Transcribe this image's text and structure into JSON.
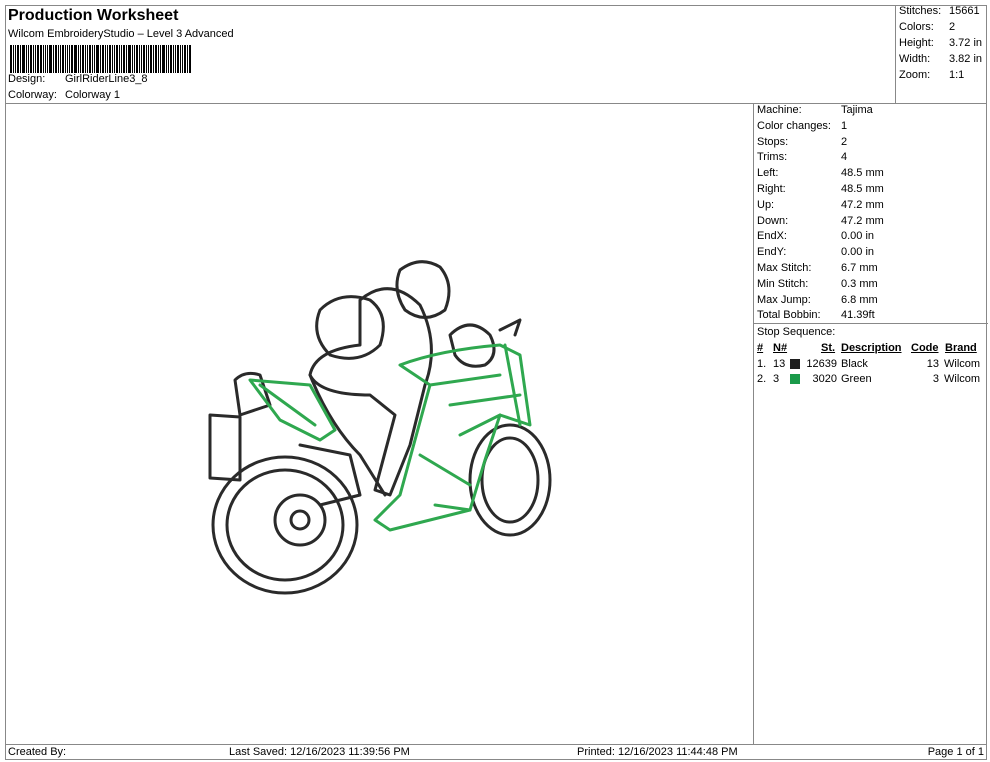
{
  "header": {
    "title": "Production Worksheet",
    "subtitle": "Wilcom EmbroideryStudio – Level 3 Advanced",
    "design_label": "Design:",
    "design": "GirlRiderLine3_8",
    "colorway_label": "Colorway:",
    "colorway": "Colorway 1"
  },
  "stats": [
    {
      "label": "Stitches:",
      "value": "15661"
    },
    {
      "label": "Colors:",
      "value": "2"
    },
    {
      "label": "Height:",
      "value": "3.72 in"
    },
    {
      "label": "Width:",
      "value": "3.82 in"
    },
    {
      "label": "Zoom:",
      "value": "1:1"
    }
  ],
  "details": [
    {
      "label": "Machine:",
      "value": "Tajima"
    },
    {
      "label": "Color changes:",
      "value": "1"
    },
    {
      "label": "Stops:",
      "value": "2"
    },
    {
      "label": "Trims:",
      "value": "4"
    },
    {
      "label": "Left:",
      "value": "48.5 mm"
    },
    {
      "label": "Right:",
      "value": "48.5 mm"
    },
    {
      "label": "Up:",
      "value": "47.2 mm"
    },
    {
      "label": "Down:",
      "value": "47.2 mm"
    },
    {
      "label": "EndX:",
      "value": "0.00 in"
    },
    {
      "label": "EndY:",
      "value": "0.00 in"
    },
    {
      "label": "Max Stitch:",
      "value": "6.7 mm"
    },
    {
      "label": "Min Stitch:",
      "value": "0.3 mm"
    },
    {
      "label": "Max Jump:",
      "value": "6.8 mm"
    },
    {
      "label": "Total Bobbin:",
      "value": "41.39ft"
    }
  ],
  "stop_sequence": {
    "title": "Stop Sequence:",
    "headers": [
      "#",
      "N#",
      "St.",
      "Description",
      "Code",
      "Brand"
    ],
    "rows": [
      {
        "num": "1.",
        "n": "13",
        "color": "#1e1e1e",
        "st": "12639",
        "desc": "Black",
        "code": "13",
        "brand": "Wilcom"
      },
      {
        "num": "2.",
        "n": "3",
        "color": "#1a9a4a",
        "st": "3020",
        "desc": "Green",
        "code": "3",
        "brand": "Wilcom"
      }
    ]
  },
  "footer": {
    "created": "Created By:",
    "saved": "Last Saved: 12/16/2023 11:39:56 PM",
    "printed": "Printed: 12/16/2023 11:44:48 PM",
    "page": "Page 1 of 1"
  },
  "colors": {
    "thread_black": "#2a2a2a",
    "thread_green": "#2fa84f"
  }
}
